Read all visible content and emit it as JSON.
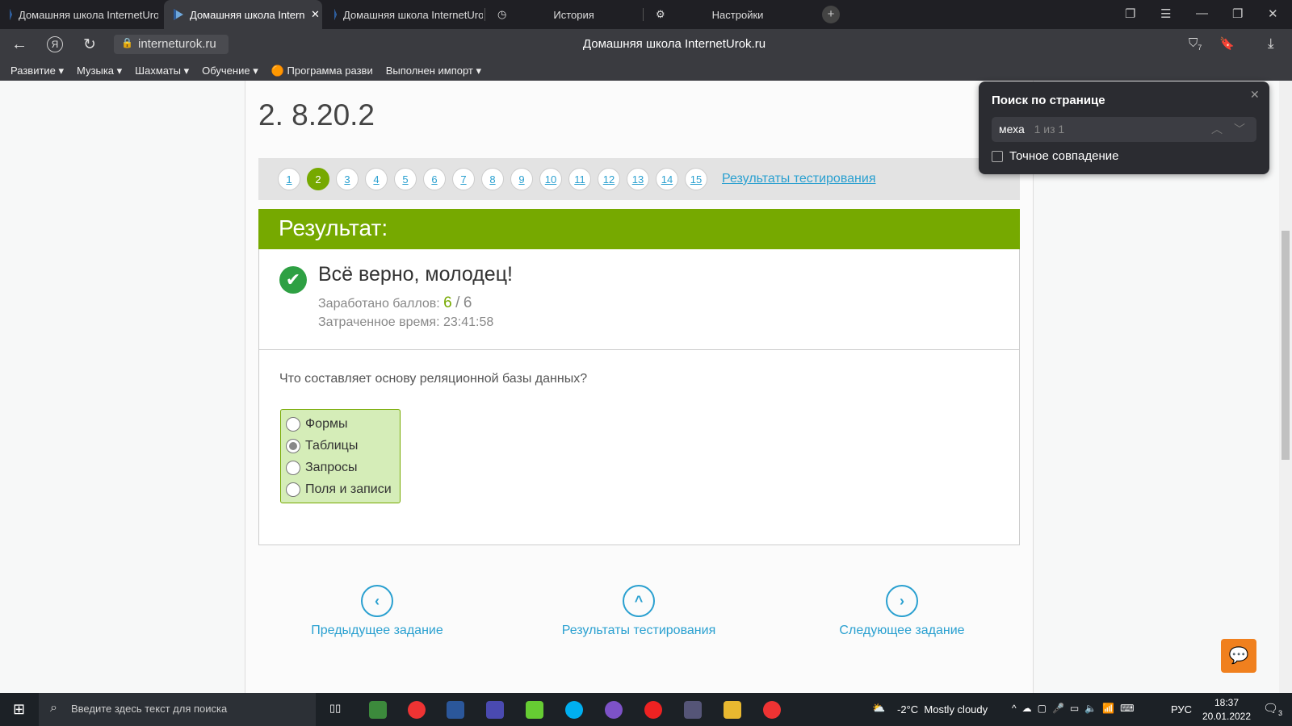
{
  "browser": {
    "tabs": [
      {
        "title": "Домашняя школа InternetUrok.ru"
      },
      {
        "title": "Домашняя школа InternetUrok.ru",
        "active": true
      },
      {
        "title": "Домашняя школа InternetUrok.ru"
      },
      {
        "title": "История"
      },
      {
        "title": "Настройки"
      }
    ],
    "url": "interneturok.ru",
    "page_title": "Домашняя школа InternetUrok.ru",
    "downloads_badge": "7",
    "bookmarks": [
      "Развитие ▾",
      "Музыка ▾",
      "Шахматы ▾",
      "Обучение ▾",
      "Программа разви",
      "Выполнен импорт ▾"
    ]
  },
  "task": {
    "title": "2. 8.20.2",
    "pages": [
      "1",
      "2",
      "3",
      "4",
      "5",
      "6",
      "7",
      "8",
      "9",
      "10",
      "11",
      "12",
      "13",
      "14",
      "15"
    ],
    "current_page": "2",
    "results_link": "Результаты тестирования",
    "result_header": "Результат:",
    "verdict": "Всё верно, молодец!",
    "score_label": "Заработано баллов:",
    "score_got": "6",
    "score_sep": "/",
    "score_max": "6",
    "time_label": "Затраченное время:",
    "time_value": "23:41:58",
    "question": "Что составляет основу реляционной базы данных?",
    "answers": [
      "Формы",
      "Таблицы",
      "Запросы",
      "Поля и записи"
    ],
    "selected": "Таблицы",
    "nav": {
      "prev": "Предыдущее задание",
      "results": "Результаты тестирования",
      "next": "Следующее задание"
    }
  },
  "find": {
    "title": "Поиск по странице",
    "query": "меха",
    "count": "1 из 1",
    "exact_label": "Точное совпадение",
    "exact_checked": false
  },
  "taskbar": {
    "search_placeholder": "Введите здесь текст для поиска",
    "weather_temp": "-2°C",
    "weather_text": "Mostly cloudy",
    "lang": "РУС",
    "time": "18:37",
    "date": "20.01.2022",
    "notifications": "3"
  },
  "colors": {
    "green": "#76a900",
    "link": "#2aa0d0",
    "chat": "#f0801e"
  }
}
